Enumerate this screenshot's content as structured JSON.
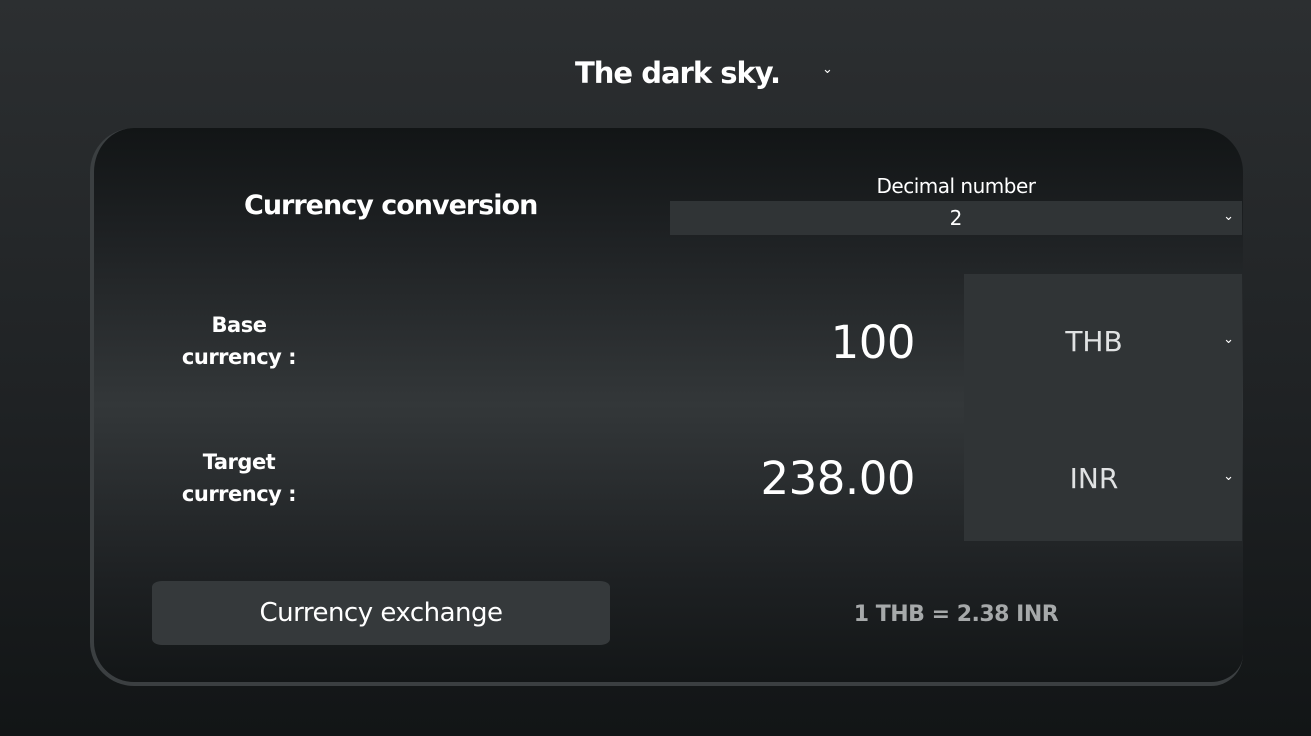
{
  "theme": {
    "selected": "The dark sky.",
    "chevron_icon": "chevron-down-icon"
  },
  "converter": {
    "title": "Currency conversion",
    "decimal": {
      "label": "Decimal number",
      "value": "2"
    },
    "base": {
      "label_line1": "Base",
      "label_line2": "currency :",
      "amount": "100",
      "currency": "THB"
    },
    "target": {
      "label_line1": "Target",
      "label_line2": "currency :",
      "amount": "238.00",
      "currency": "INR"
    },
    "exchange_button": "Currency exchange",
    "rate": "1 THB = 2.38 INR"
  },
  "colors": {
    "panel": "#303436",
    "button": "#35393b",
    "rate_text": "#a6a9aa"
  }
}
